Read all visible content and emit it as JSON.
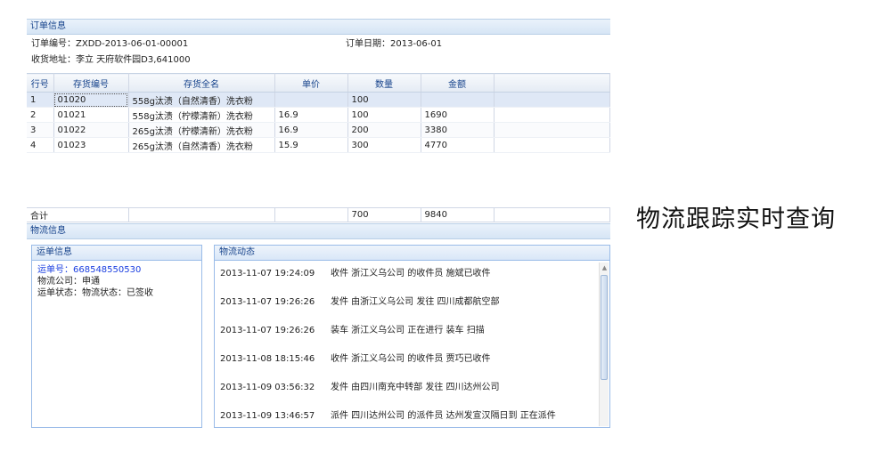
{
  "order": {
    "header": "订单信息",
    "number": "订单编号：ZXDD-2013-06-01-00001",
    "date": "订单日期：2013-06-01",
    "address": "收货地址：李立  天府软件园D3,641000",
    "columns": [
      "行号",
      "存货编号",
      "存货全名",
      "单价",
      "数量",
      "金额"
    ],
    "rows": [
      {
        "no": "1",
        "code": "01020",
        "name": "558g汰渍（自然清香）洗衣粉",
        "price": "",
        "qty": "100",
        "amount": ""
      },
      {
        "no": "2",
        "code": "01021",
        "name": "558g汰渍（柠檬清新）洗衣粉",
        "price": "16.9",
        "qty": "100",
        "amount": "1690"
      },
      {
        "no": "3",
        "code": "01022",
        "name": "265g汰渍（柠檬清新）洗衣粉",
        "price": "16.9",
        "qty": "200",
        "amount": "3380"
      },
      {
        "no": "4",
        "code": "01023",
        "name": "265g汰渍（自然清香）洗衣粉",
        "price": "15.9",
        "qty": "300",
        "amount": "4770"
      }
    ],
    "total": {
      "label": "合计",
      "qty": "700",
      "amount": "9840"
    }
  },
  "logistics": {
    "header": "物流信息",
    "waybill": {
      "title": "运单信息",
      "number": "运单号：668548550530",
      "company": "物流公司：申通",
      "status": "运单状态：物流状态：已签收"
    },
    "tracking": {
      "title": "物流动态",
      "events": [
        {
          "time": "2013-11-07 19:24:09",
          "desc": "收件 浙江义乌公司 的收件员 施斌已收件"
        },
        {
          "time": "2013-11-07 19:26:26",
          "desc": "发件 由浙江义乌公司 发往 四川成都航空部"
        },
        {
          "time": "2013-11-07 19:26:26",
          "desc": "装车 浙江义乌公司 正在进行 装车 扫描"
        },
        {
          "time": "2013-11-08 18:15:46",
          "desc": "收件 浙江义乌公司 的收件员 贾巧已收件"
        },
        {
          "time": "2013-11-09 03:56:32",
          "desc": "发件 由四川南充中转部 发往 四川达州公司"
        },
        {
          "time": "2013-11-09 13:46:57",
          "desc": "派件 四川达州公司 的派件员 达州发宣汉隔日到 正在派件"
        }
      ]
    }
  },
  "side_title": "物流跟踪实时查询",
  "icons": {
    "scroll_up": "chevron-up-icon"
  }
}
